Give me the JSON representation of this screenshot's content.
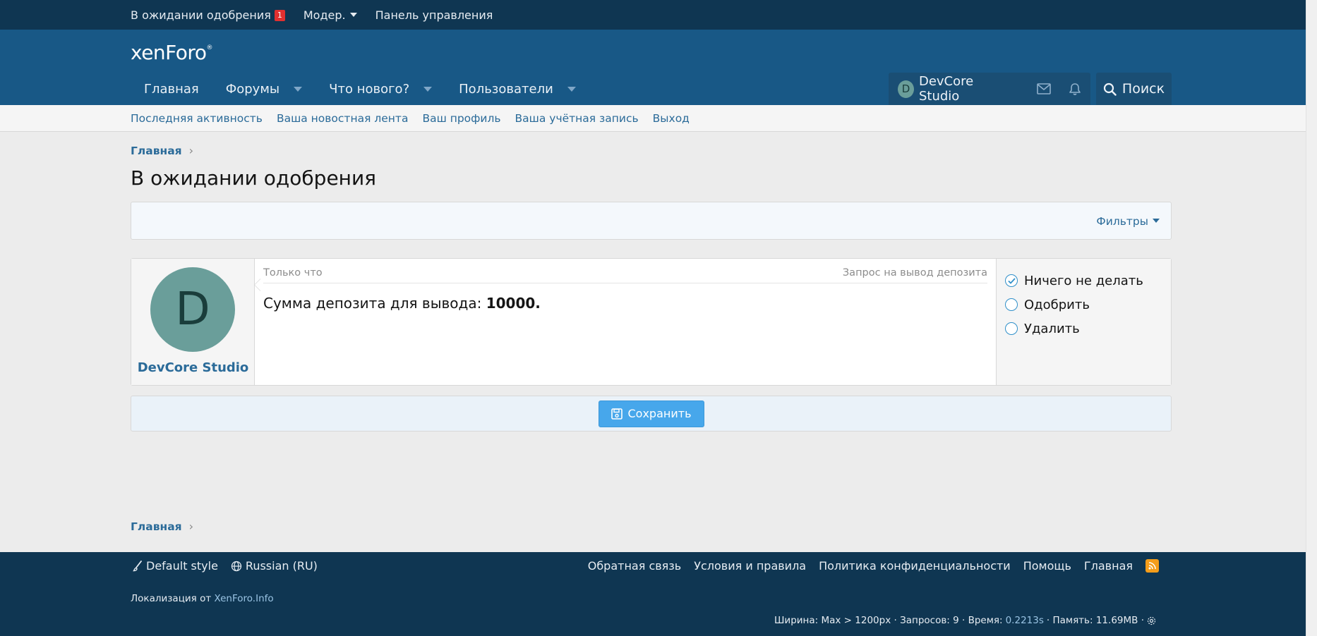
{
  "staffbar": {
    "pending_label": "В ожидании одобрения",
    "pending_count": "1",
    "moder_label": "Модер.",
    "admin_label": "Панель управления"
  },
  "header": {
    "logo_text": "xenForo",
    "nav": [
      {
        "label": "Главная"
      },
      {
        "label": "Форумы"
      },
      {
        "label": "Что нового?"
      },
      {
        "label": "Пользователи"
      }
    ],
    "user": {
      "avatar_letter": "D",
      "name": "DevCore Studio"
    },
    "search_label": "Поиск"
  },
  "subnav": [
    "Последняя активность",
    "Ваша новостная лента",
    "Ваш профиль",
    "Ваша учётная запись",
    "Выход"
  ],
  "breadcrumb": "Главная",
  "page_title": "В ожидании одобрения",
  "filters_label": "Фильтры",
  "post": {
    "avatar_letter": "D",
    "username": "DevCore Studio",
    "time": "Только что",
    "type": "Запрос на вывод депозита",
    "body_prefix": "Сумма депозита для вывода: ",
    "body_value": "10000.",
    "actions": [
      {
        "label": "Ничего не делать",
        "checked": true
      },
      {
        "label": "Одобрить",
        "checked": false
      },
      {
        "label": "Удалить",
        "checked": false
      }
    ]
  },
  "save_label": "Сохранить",
  "footer": {
    "style_label": "Default style",
    "language_label": "Russian (RU)",
    "links": [
      "Обратная связь",
      "Условия и правила",
      "Политика конфиденциальности",
      "Помощь",
      "Главная"
    ],
    "localization_prefix": "Локализация от ",
    "localization_link": "XenForo.Info",
    "stats_prefix": "Ширина: Max > 1200px · Запросов: 9 · Время:",
    "stats_time": "0.2213s",
    "stats_suffix": "· Память: 11.69MB ·"
  },
  "colors": {
    "header": "#185886",
    "staffbar": "#0f3652",
    "link": "#2b6b99",
    "button": "#47a7eb",
    "badge": "#e03030"
  }
}
